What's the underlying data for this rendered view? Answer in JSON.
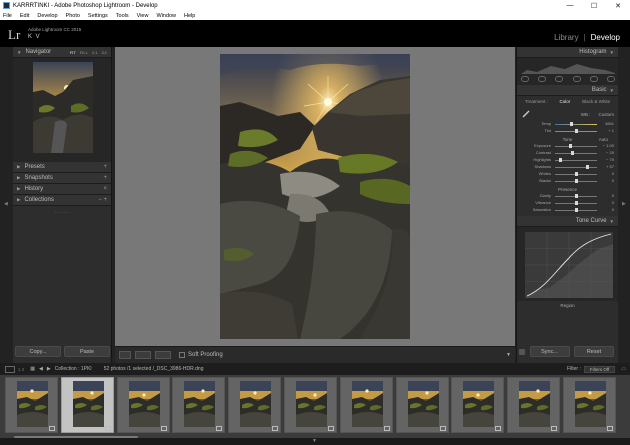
{
  "window": {
    "title": "KARRRTINKI - Adobe Photoshop Lightroom - Develop",
    "minimize": "—",
    "maximize": "☐",
    "close": "✕"
  },
  "menu": [
    "File",
    "Edit",
    "Develop",
    "Photo",
    "Settings",
    "Tools",
    "View",
    "Window",
    "Help"
  ],
  "identity": {
    "logo": "Lr",
    "version": "Adobe Lightroom CC 2015",
    "user": "K V"
  },
  "modules": {
    "library": "Library",
    "separator": "|",
    "develop": "Develop"
  },
  "left_panel": {
    "navigator": {
      "title": "Navigator",
      "zoom_options": [
        "FIT",
        "FILL",
        "1:1",
        "3:1"
      ]
    },
    "sections": [
      {
        "title": "Presets",
        "control": "+"
      },
      {
        "title": "Snapshots",
        "control": "+"
      },
      {
        "title": "History",
        "control": "×"
      },
      {
        "title": "Collections",
        "control": "− +"
      }
    ],
    "copy_button": "Copy...",
    "paste_button": "Paste"
  },
  "toolbar": {
    "soft_proofing": "Soft Proofing"
  },
  "right_panel": {
    "histogram_title": "Histogram",
    "basic_title": "Basic",
    "treatment_label": "Treatment :",
    "treatment_color": "Color",
    "treatment_bw": "Black & White",
    "wb_label": "WB :",
    "wb_value": "Custom",
    "temp": {
      "label": "Temp",
      "value": "4841",
      "pos": 0.4
    },
    "tint": {
      "label": "Tint",
      "value": "+ 1",
      "pos": 0.5
    },
    "tone_label": "Tone",
    "tone_auto": "Auto",
    "tone_sliders": [
      {
        "label": "Exposure",
        "value": "− 1.00",
        "pos": 0.38
      },
      {
        "label": "Contrast",
        "value": "− 20",
        "pos": 0.42
      },
      {
        "label": "Highlights",
        "value": "− 75",
        "pos": 0.12
      },
      {
        "label": "Shadows",
        "value": "+ 57",
        "pos": 0.78
      },
      {
        "label": "Whites",
        "value": "0",
        "pos": 0.5
      },
      {
        "label": "Blacks",
        "value": "0",
        "pos": 0.5
      }
    ],
    "presence_label": "Presence",
    "presence_sliders": [
      {
        "label": "Clarity",
        "value": "0",
        "pos": 0.5
      },
      {
        "label": "Vibrance",
        "value": "0",
        "pos": 0.5
      },
      {
        "label": "Saturation",
        "value": "0",
        "pos": 0.5
      }
    ],
    "tone_curve_title": "Tone Curve",
    "region_label": "Region",
    "sync_button": "Sync...",
    "reset_button": "Reset"
  },
  "filmstrip": {
    "page_numbers": "1 2",
    "breadcrumb": "Collection : 1PKI",
    "count": "52 photos /1 selected /_DSC_3986-HDR.dng",
    "filter_label": "Filter :",
    "filter_value": "Filters Off",
    "thumb_count": 11,
    "selected_index": 1
  },
  "colors": {
    "panel_bg": "#2d2d2d",
    "center_bg": "#787878",
    "sky": "#c7a04a",
    "sun": "#ffe08a",
    "rock": "#4a4a44",
    "grass": "#5e6e2a"
  },
  "icons": {
    "picker": "eyedropper-icon",
    "tool_crop": "crop-icon",
    "tool_spot": "spot-removal-icon",
    "tool_redeye": "red-eye-icon",
    "tool_gradient": "graduated-filter-icon",
    "tool_radial": "radial-filter-icon",
    "tool_brush": "adjustment-brush-icon"
  }
}
